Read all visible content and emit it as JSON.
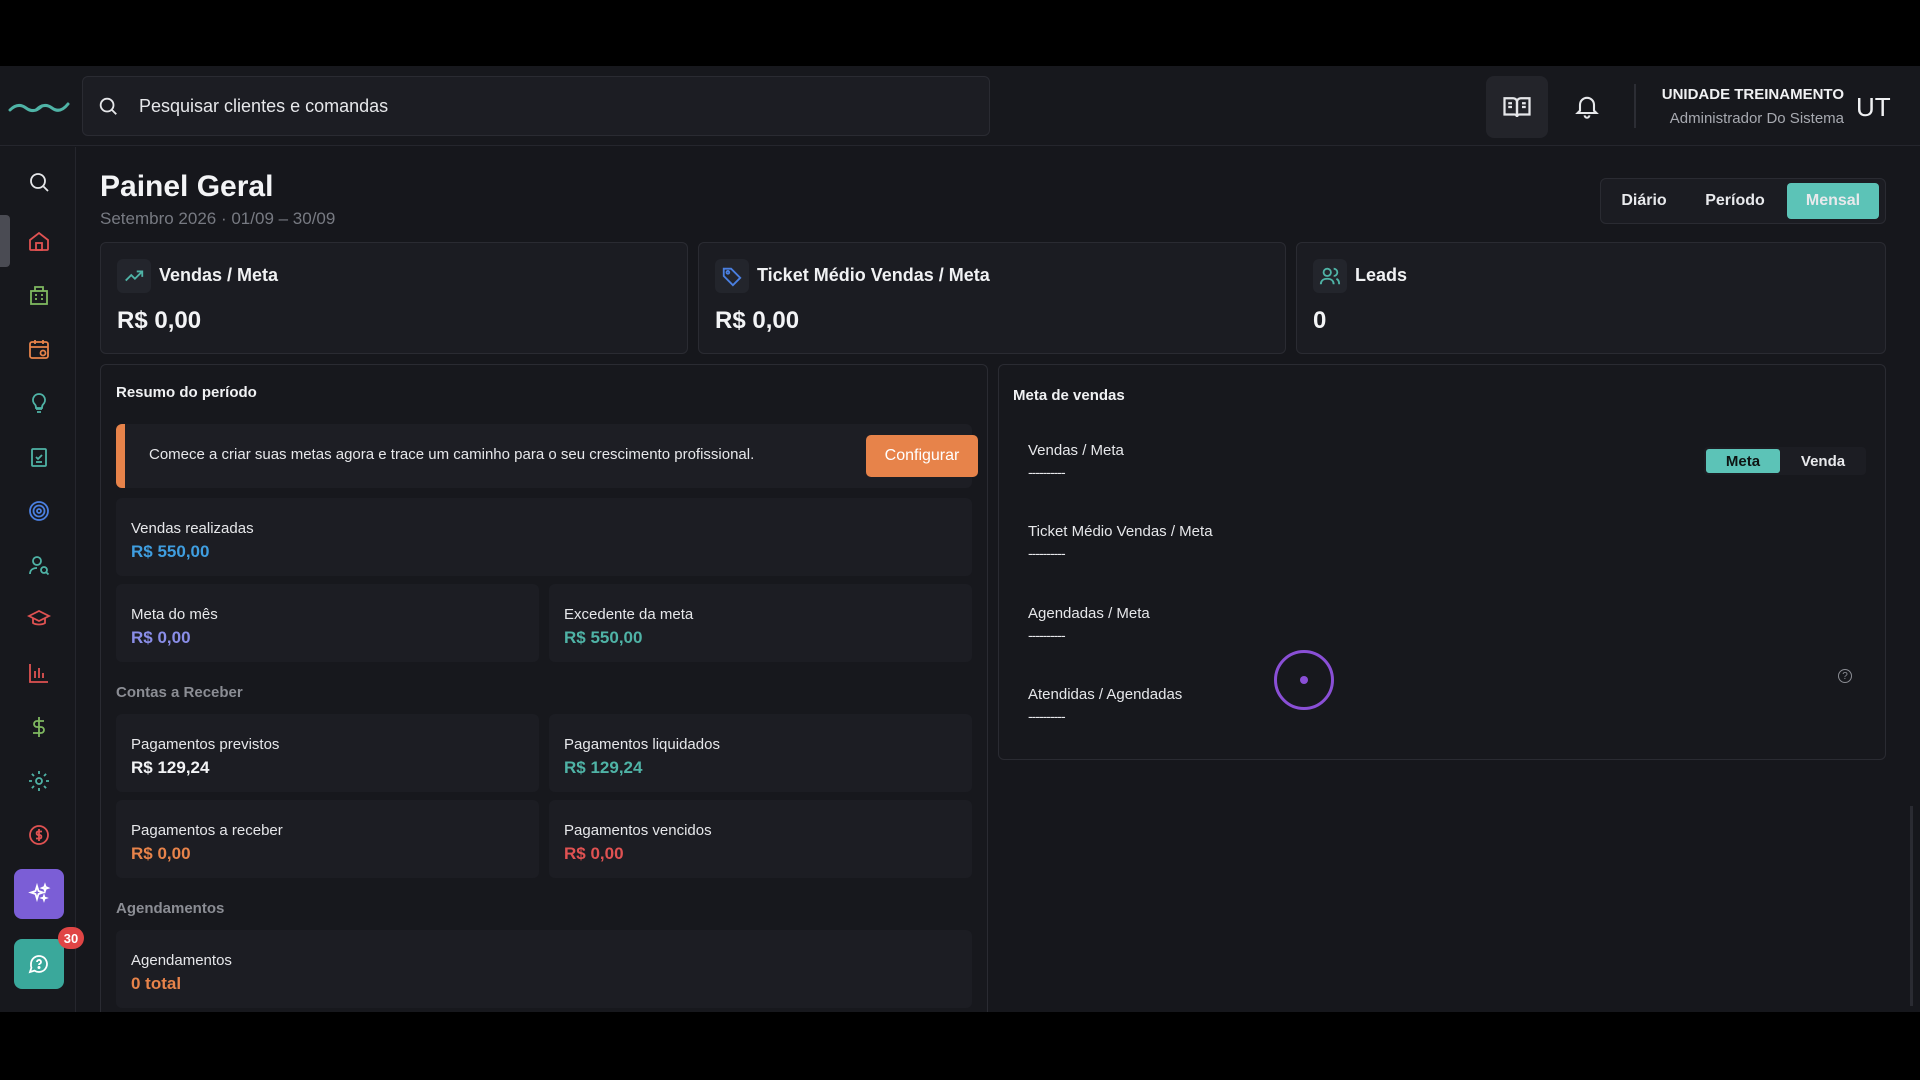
{
  "search": {
    "placeholder": "Pesquisar clientes e comandas"
  },
  "user": {
    "unit": "UNIDADE TREINAMENTO",
    "role": "Administrador Do Sistema",
    "initials": "UT"
  },
  "page": {
    "title": "Painel Geral",
    "subtitle": "Setembro 2026 · 01/09 – 30/09"
  },
  "period_tabs": {
    "daily": "Diário",
    "period": "Período",
    "monthly": "Mensal",
    "selected": "Mensal"
  },
  "kpis": [
    {
      "label": "Vendas / Meta",
      "value": "R$ 0,00",
      "icon": "trending-up-icon"
    },
    {
      "label": "Ticket Médio Vendas / Meta",
      "value": "R$ 0,00",
      "icon": "tag-icon"
    },
    {
      "label": "Leads",
      "value": "0",
      "icon": "users-icon"
    }
  ],
  "resumo": {
    "title": "Resumo do período",
    "alert_text": "Comece a criar suas metas agora e trace um caminho para o seu crescimento profissional.",
    "configure_label": "Configurar",
    "vendas_realizadas": {
      "label": "Vendas realizadas",
      "value": "R$ 550,00"
    },
    "meta_mes": {
      "label": "Meta do mês",
      "value": "R$ 0,00"
    },
    "excedente": {
      "label": "Excedente da meta",
      "value": "R$ 550,00"
    },
    "contas_title": "Contas a Receber",
    "pag_previstos": {
      "label": "Pagamentos previstos",
      "value": "R$ 129,24"
    },
    "pag_liquidados": {
      "label": "Pagamentos liquidados",
      "value": "R$ 129,24"
    },
    "pag_receber": {
      "label": "Pagamentos a receber",
      "value": "R$ 0,00"
    },
    "pag_vencidos": {
      "label": "Pagamentos vencidos",
      "value": "R$ 0,00"
    },
    "agend_title": "Agendamentos",
    "agendamentos": {
      "label": "Agendamentos",
      "value": "0 total"
    }
  },
  "meta_vendas": {
    "title": "Meta de vendas",
    "tab_meta": "Meta",
    "tab_venda": "Venda",
    "rows": [
      {
        "label": "Vendas / Meta",
        "value": "----------"
      },
      {
        "label": "Ticket Médio Vendas / Meta",
        "value": "----------"
      },
      {
        "label": "Agendadas / Meta",
        "value": "----------"
      },
      {
        "label": "Atendidas / Agendadas",
        "value": "----------"
      }
    ],
    "help": "?"
  },
  "sidebar": {
    "items": [
      "search-icon",
      "home-icon",
      "building-icon",
      "calendar-icon",
      "lightbulb-icon",
      "clipboard-check-icon",
      "target-icon",
      "user-search-icon",
      "graduation-cap-icon",
      "bar-chart-icon",
      "dollar-icon",
      "settings-icon",
      "coin-icon",
      "ai-sparkle-icon",
      "chat-icon"
    ],
    "chat_badge": "30"
  },
  "colors": {
    "accent": "#5cc3b7",
    "orange": "#e7834a",
    "blue": "#3f9ee0",
    "purple": "#8a8ee8",
    "teal": "#4fb3a6",
    "red": "#e05252",
    "ai": "#7b5ed6"
  }
}
